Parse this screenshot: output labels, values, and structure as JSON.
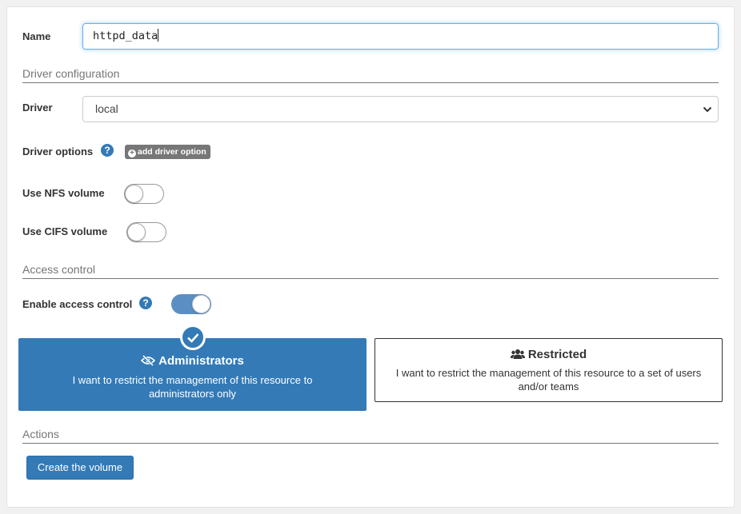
{
  "form": {
    "name_label": "Name",
    "name_value": "httpd_data",
    "driver_config_title": "Driver configuration",
    "driver_label": "Driver",
    "driver_value": "local",
    "driver_options_label": "Driver options",
    "add_driver_option_label": "add driver option",
    "use_nfs_label": "Use NFS volume",
    "use_nfs_on": false,
    "use_cifs_label": "Use CIFS volume",
    "use_cifs_on": false,
    "access_control_title": "Access control",
    "enable_access_label": "Enable access control",
    "enable_access_on": true
  },
  "access_options": [
    {
      "title": "Administrators",
      "description": "I want to restrict the management of this resource to administrators only",
      "icon": "eye-slash-icon",
      "selected": true
    },
    {
      "title": "Restricted",
      "description": "I want to restrict the management of this resource to a set of users and/or teams",
      "icon": "users-icon",
      "selected": false
    }
  ],
  "actions": {
    "title": "Actions",
    "create_label": "Create the volume"
  },
  "colors": {
    "primary": "#337ab7",
    "toggle_on": "#5b8fc4",
    "badge_gray": "#777777",
    "focus_border": "#66afe9"
  }
}
